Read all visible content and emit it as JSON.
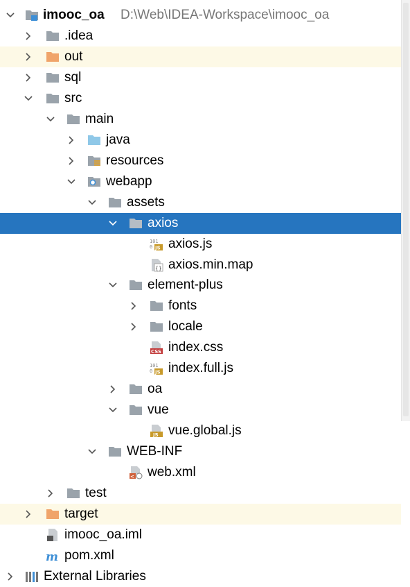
{
  "project": {
    "name": "imooc_oa",
    "path": "D:\\Web\\IDEA-Workspace\\imooc_oa"
  },
  "colors": {
    "folder": "#9aa3ab",
    "folder_excluded": "#f0a46a",
    "folder_source": "#8fc8e8",
    "selection": "#2675bf",
    "highlight": "#fdf9e6",
    "js_badge": "#c89a2a",
    "css_badge": "#c23b3b"
  },
  "tree": [
    {
      "label": "imooc_oa",
      "icon": "module-folder-icon",
      "expanded": true
    },
    {
      "label": ".idea",
      "icon": "folder-icon",
      "expanded": false
    },
    {
      "label": "out",
      "icon": "excluded-folder-icon",
      "expanded": false
    },
    {
      "label": "sql",
      "icon": "folder-icon",
      "expanded": false
    },
    {
      "label": "src",
      "icon": "folder-icon",
      "expanded": true
    },
    {
      "label": "main",
      "icon": "folder-icon",
      "expanded": true
    },
    {
      "label": "java",
      "icon": "source-folder-icon",
      "expanded": false
    },
    {
      "label": "resources",
      "icon": "resources-folder-icon",
      "expanded": false
    },
    {
      "label": "webapp",
      "icon": "web-folder-icon",
      "expanded": true
    },
    {
      "label": "assets",
      "icon": "folder-icon",
      "expanded": true
    },
    {
      "label": "axios",
      "icon": "folder-icon",
      "expanded": true,
      "selected": true
    },
    {
      "label": "axios.js",
      "icon": "js-file-icon"
    },
    {
      "label": "axios.min.map",
      "icon": "json-map-file-icon"
    },
    {
      "label": "element-plus",
      "icon": "folder-icon",
      "expanded": true
    },
    {
      "label": "fonts",
      "icon": "folder-icon",
      "expanded": false
    },
    {
      "label": "locale",
      "icon": "folder-icon",
      "expanded": false
    },
    {
      "label": "index.css",
      "icon": "css-file-icon"
    },
    {
      "label": "index.full.js",
      "icon": "js-file-icon"
    },
    {
      "label": "oa",
      "icon": "folder-icon",
      "expanded": false
    },
    {
      "label": "vue",
      "icon": "folder-icon",
      "expanded": true
    },
    {
      "label": "vue.global.js",
      "icon": "js-plain-file-icon"
    },
    {
      "label": "WEB-INF",
      "icon": "folder-icon",
      "expanded": true
    },
    {
      "label": "web.xml",
      "icon": "xml-file-icon"
    },
    {
      "label": "test",
      "icon": "folder-icon",
      "expanded": false
    },
    {
      "label": "target",
      "icon": "excluded-folder-icon",
      "expanded": false
    },
    {
      "label": "imooc_oa.iml",
      "icon": "iml-file-icon"
    },
    {
      "label": "pom.xml",
      "icon": "maven-file-icon"
    },
    {
      "label": "External Libraries",
      "icon": "libraries-icon",
      "expanded": false
    }
  ]
}
